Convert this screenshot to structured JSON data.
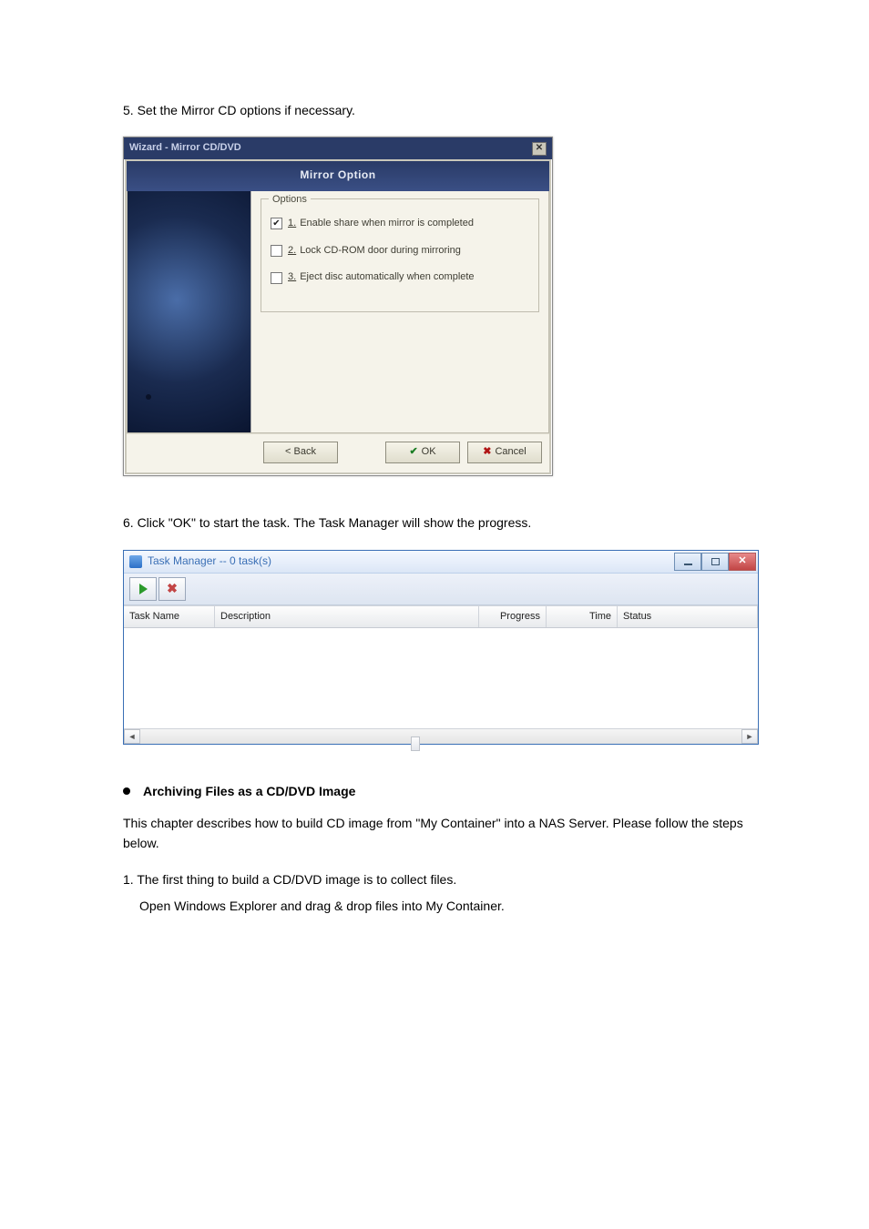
{
  "doc": {
    "step5": "5. Set the Mirror CD options if necessary.",
    "step6": "6. Click \"OK\" to start the task. The Task Manager will show the progress.",
    "bullet": "Archiving Files as a CD/DVD Image",
    "desc": "This chapter describes how to build CD image from \"My Container\" into a NAS Server. Please follow the steps below.",
    "p1": "1. The first thing to build a CD/DVD image is to collect files.",
    "p1b": "Open Windows Explorer and drag & drop files into My Container."
  },
  "wizard": {
    "title": "Wizard - Mirror CD/DVD",
    "banner": "Mirror Option",
    "group": "Options",
    "opts": [
      {
        "num": "1.",
        "label": "Enable share when mirror is completed",
        "checked": true
      },
      {
        "num": "2.",
        "label": "Lock CD-ROM door during mirroring",
        "checked": false
      },
      {
        "num": "3.",
        "label": "Eject disc automatically when complete",
        "checked": false
      }
    ],
    "back": "< Back",
    "ok": "OK",
    "cancel": "Cancel"
  },
  "tm": {
    "title": "Task Manager -- 0 task(s)",
    "cols": {
      "task": "Task Name",
      "desc": "Description",
      "prog": "Progress",
      "time": "Time",
      "status": "Status"
    }
  }
}
